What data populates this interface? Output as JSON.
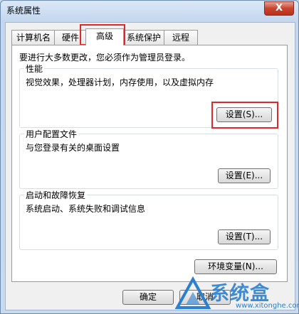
{
  "window": {
    "title": "系统属性",
    "close_label": "X"
  },
  "tabs": [
    {
      "label": "计算机名"
    },
    {
      "label": "硬件"
    },
    {
      "label": "高级"
    },
    {
      "label": "系统保护"
    },
    {
      "label": "远程"
    }
  ],
  "panel": {
    "notice": "要进行大多数更改，您必须作为管理员登录。",
    "performance": {
      "title": "性能",
      "desc": "视觉效果，处理器计划，内存使用，以及虚拟内存",
      "button": "设置(S)..."
    },
    "profile": {
      "title": "用户配置文件",
      "desc": "与您登录有关的桌面设置",
      "button": "设置(E)..."
    },
    "startup": {
      "title": "启动和故障恢复",
      "desc": "系统启动、系统失败和调试信息",
      "button": "设置(T)..."
    },
    "env_button": "环境变量(N)..."
  },
  "footer": {
    "ok": "确定",
    "cancel": "取消"
  },
  "watermark": {
    "text": "系统盒",
    "url": "www.xitonghe.com"
  },
  "colors": {
    "highlight": "#e0282c",
    "title_bar": "#c3d6ee",
    "watermark": "#2b7fd0"
  }
}
